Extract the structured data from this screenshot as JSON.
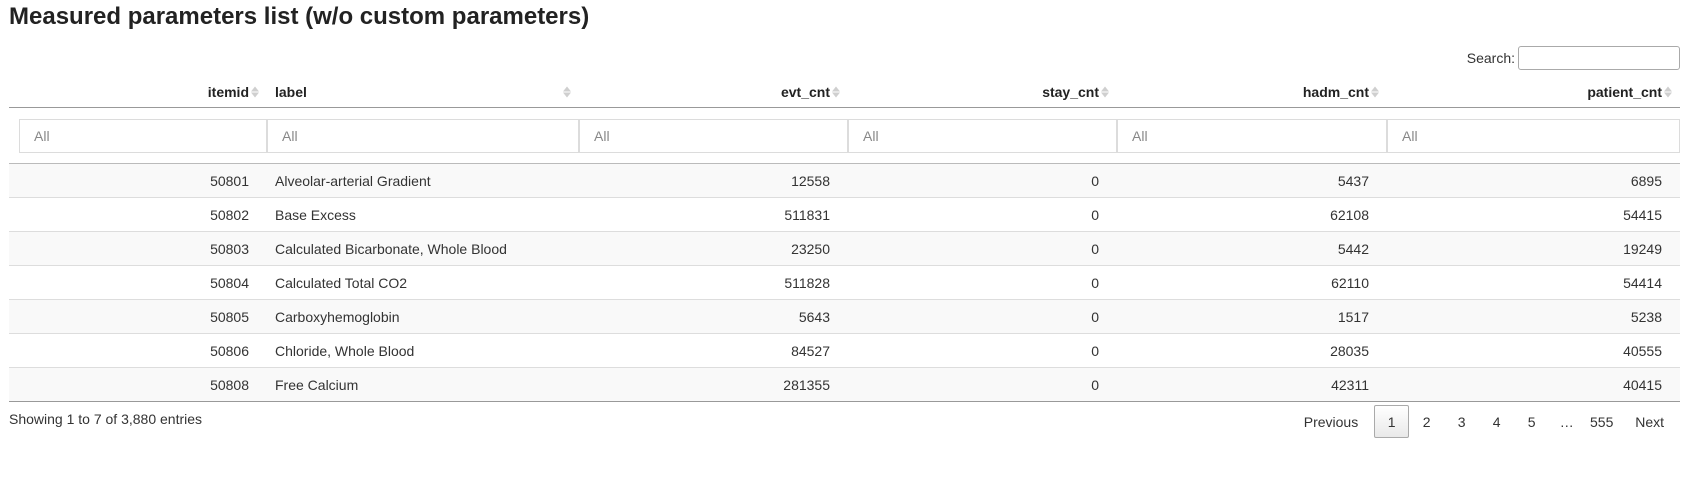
{
  "title": "Measured parameters list (w/o custom parameters)",
  "search": {
    "label": "Search:",
    "value": ""
  },
  "columns": [
    {
      "label": "itemid",
      "align": "num"
    },
    {
      "label": "label",
      "align": "txt"
    },
    {
      "label": "evt_cnt",
      "align": "num"
    },
    {
      "label": "stay_cnt",
      "align": "num"
    },
    {
      "label": "hadm_cnt",
      "align": "num"
    },
    {
      "label": "patient_cnt",
      "align": "num"
    }
  ],
  "filters": [
    "All",
    "All",
    "All",
    "All",
    "All",
    "All"
  ],
  "rows": [
    [
      "50801",
      "Alveolar-arterial Gradient",
      "12558",
      "0",
      "5437",
      "6895"
    ],
    [
      "50802",
      "Base Excess",
      "511831",
      "0",
      "62108",
      "54415"
    ],
    [
      "50803",
      "Calculated Bicarbonate, Whole Blood",
      "23250",
      "0",
      "5442",
      "19249"
    ],
    [
      "50804",
      "Calculated Total CO2",
      "511828",
      "0",
      "62110",
      "54414"
    ],
    [
      "50805",
      "Carboxyhemoglobin",
      "5643",
      "0",
      "1517",
      "5238"
    ],
    [
      "50806",
      "Chloride, Whole Blood",
      "84527",
      "0",
      "28035",
      "40555"
    ],
    [
      "50808",
      "Free Calcium",
      "281355",
      "0",
      "42311",
      "40415"
    ]
  ],
  "info": "Showing 1 to 7 of 3,880 entries",
  "pager": {
    "previous": "Previous",
    "pages": [
      "1",
      "2",
      "3",
      "4",
      "5"
    ],
    "ellipsis": "…",
    "last": "555",
    "next": "Next",
    "current": "1"
  }
}
